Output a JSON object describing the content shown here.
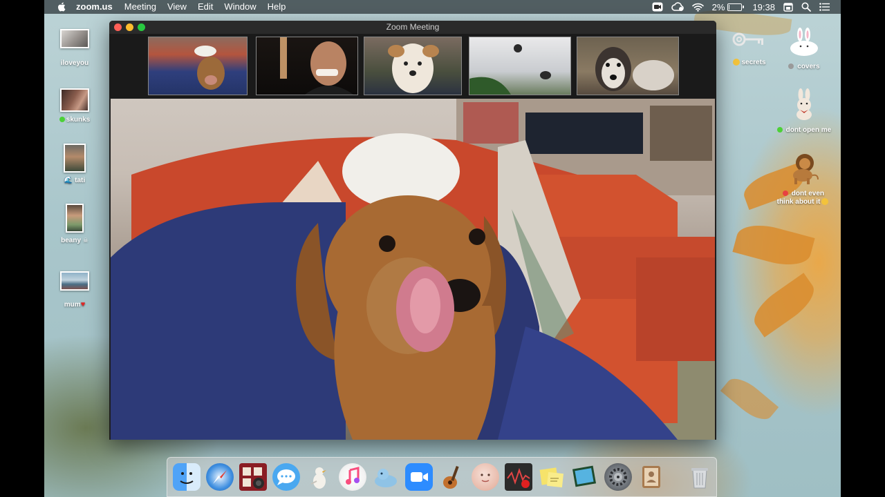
{
  "menubar": {
    "app": "zoom.us",
    "menus": [
      "Meeting",
      "View",
      "Edit",
      "Window",
      "Help"
    ],
    "battery_percent": "2%",
    "battery_level": 0.02,
    "time": "19:38",
    "icons": [
      "zoom-status-icon",
      "creative-cloud-icon",
      "wifi-icon",
      "battery-icon",
      "calendar-icon",
      "search-icon",
      "list-icon"
    ]
  },
  "window": {
    "title": "Zoom Meeting",
    "participants": [
      "dog-on-couch",
      "smiling-man",
      "white-terrier",
      "white-dog-closeup",
      "husky"
    ]
  },
  "desktop_left": [
    {
      "label": "iloveyou"
    },
    {
      "label": "skunks"
    },
    {
      "label": "tati"
    },
    {
      "label": "beany"
    },
    {
      "label": "mum"
    }
  ],
  "desktop_right": [
    {
      "label": "secrets"
    },
    {
      "label": "covers"
    },
    {
      "label": "dont open me"
    },
    {
      "label": "dont even",
      "label2": "think about it"
    }
  ],
  "colors": {
    "tag_green": "#4cd137",
    "tag_gray": "#9a9a9a",
    "tag_red": "#e84141",
    "close": "#fe5f57",
    "minimize": "#febc2e",
    "maximize": "#28c840"
  },
  "dock": [
    "finder-icon",
    "safari-icon",
    "photo-booth-icon",
    "messages-icon",
    "cyberduck-icon",
    "itunes-icon",
    "sequel-pro-icon",
    "zoom-icon",
    "garageband-icon",
    "face-app-icon",
    "screen-recorder-icon",
    "stickies-icon",
    "preview-icon",
    "system-preferences-icon",
    "contacts-icon",
    "trash-icon"
  ]
}
